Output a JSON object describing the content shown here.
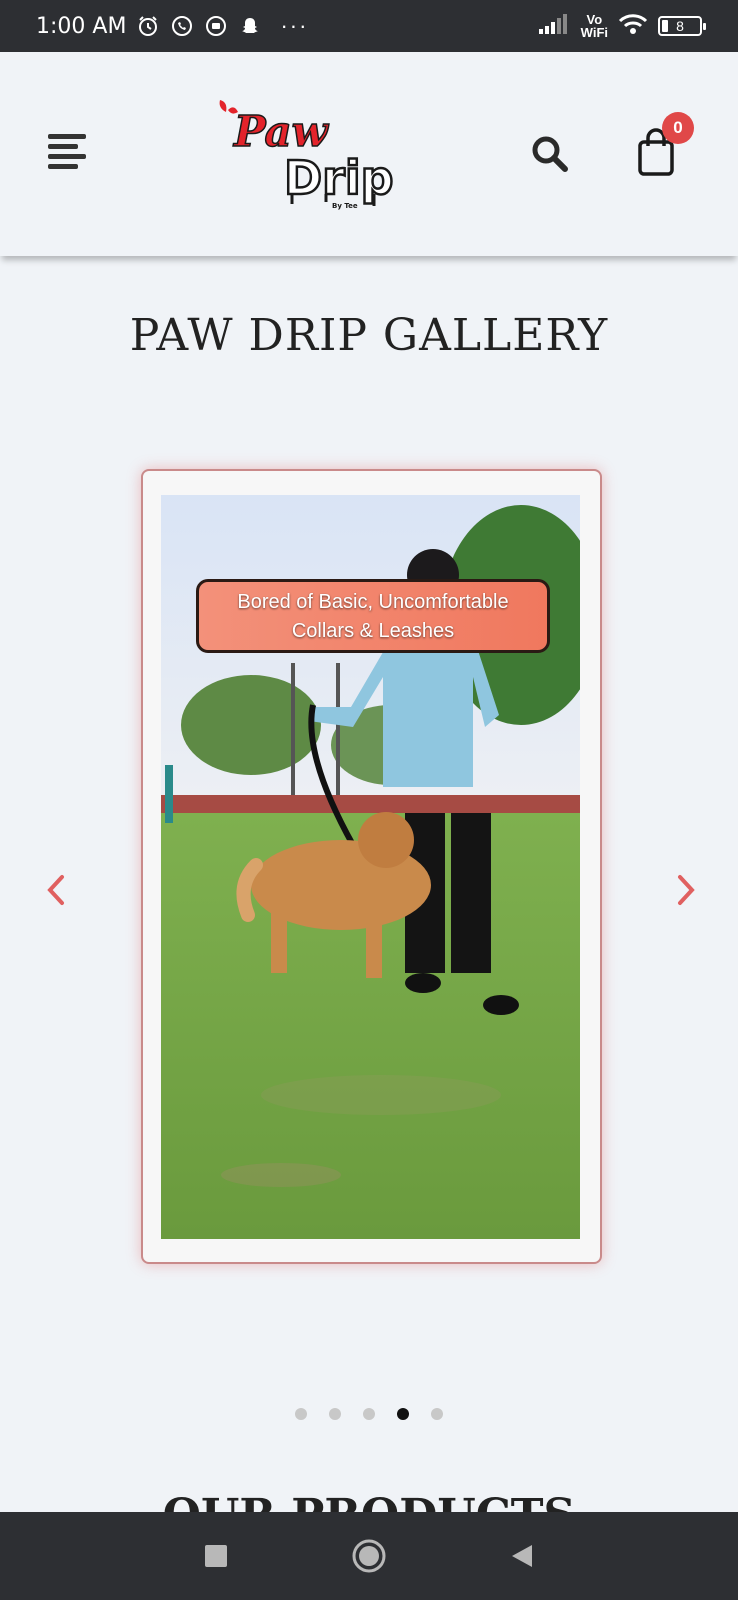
{
  "status_bar": {
    "time": "1:00 AM",
    "network": "Vo WiFi",
    "vo": "Vo",
    "wifi_label": "WiFi",
    "battery": "8",
    "more": "···"
  },
  "header": {
    "cart_count": "0",
    "logo_text_1": "Paw",
    "logo_text_2": "Drip",
    "logo_sub": "By Tee"
  },
  "gallery": {
    "title": "PAW DRIP GALLERY",
    "caption_line1": "Bored of Basic, Uncomfortable",
    "caption_line2": "Collars & Leashes",
    "slide_count": 5,
    "active_slide": 4
  },
  "products": {
    "title": "OUR PRODUCTS"
  },
  "colors": {
    "accent": "#e04848",
    "background": "#f0f3f7",
    "system_bar": "#2d2f33"
  }
}
